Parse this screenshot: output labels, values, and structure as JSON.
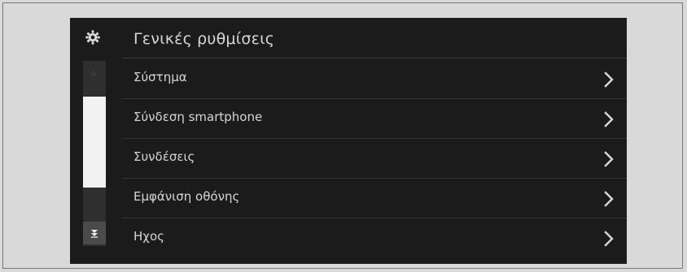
{
  "header": {
    "icon": "gear-icon",
    "title": "Γενικές ρυθμίσεις"
  },
  "menu": {
    "items": [
      {
        "label": "Σύστημα",
        "icon": "chevron-right-icon"
      },
      {
        "label": "Σύνδεση smartphone",
        "icon": "chevron-right-icon"
      },
      {
        "label": "Συνδέσεις",
        "icon": "chevron-right-icon"
      },
      {
        "label": "Εμφάνιση οθόνης",
        "icon": "chevron-right-icon"
      },
      {
        "label": "Ηχος",
        "icon": "chevron-right-icon"
      }
    ]
  },
  "scrollbar": {
    "up_icon": "scroll-up-icon",
    "down_icon": "scroll-down-icon"
  },
  "colors": {
    "page_background": "#d9d9d9",
    "screen_background": "#1b1b1b",
    "text": "#d6d6d6",
    "divider": "#343434",
    "scroll_thumb": "#f2f2f2",
    "scroll_track": "#2f2f2f"
  }
}
